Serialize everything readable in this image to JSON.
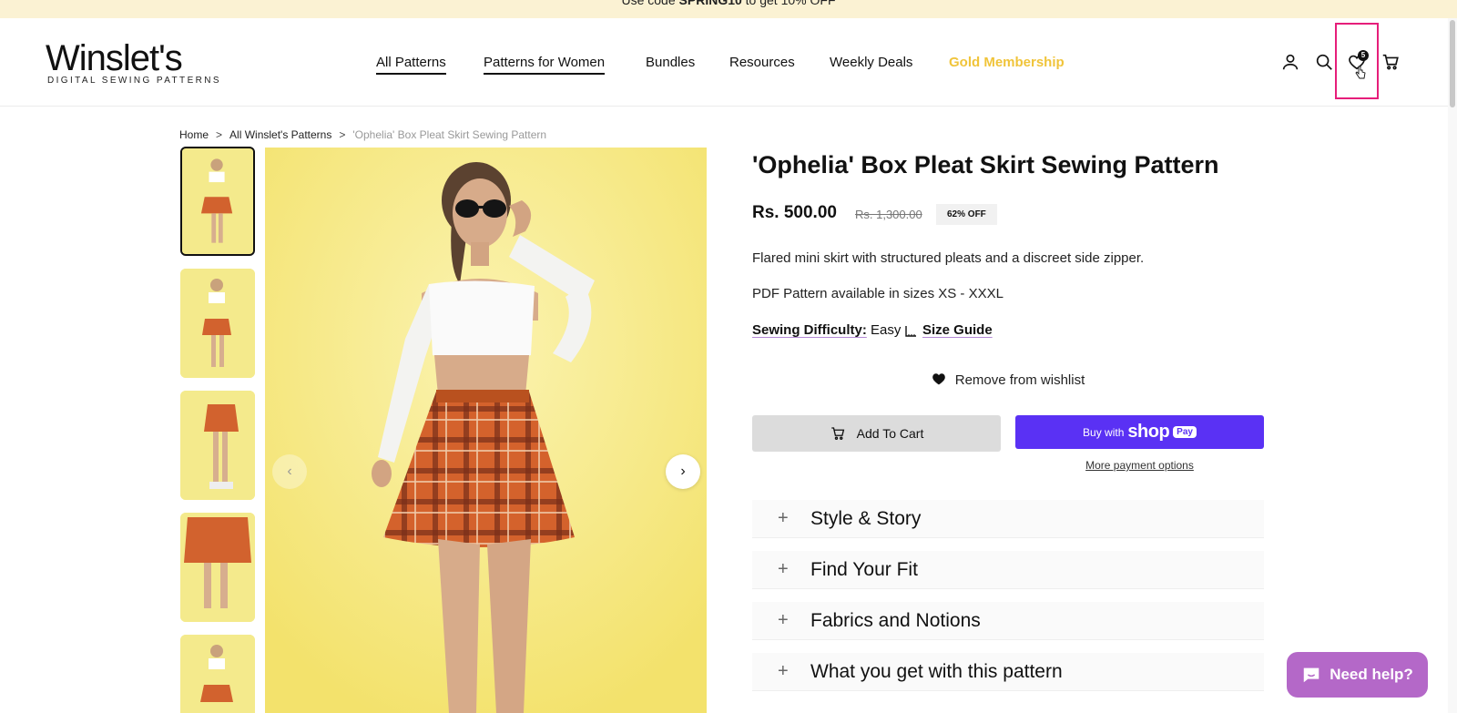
{
  "announcement": {
    "prefix": "Use code ",
    "code": "SPRING10",
    "suffix": " to get 10% OFF"
  },
  "logo": {
    "wordmark": "Winslet's",
    "tagline": "DIGITAL SEWING PATTERNS"
  },
  "nav": {
    "items": [
      {
        "label": "All Patterns"
      },
      {
        "label": "Patterns for Women"
      },
      {
        "label": "Bundles"
      },
      {
        "label": "Resources"
      },
      {
        "label": "Weekly Deals"
      },
      {
        "label": "Gold Membership"
      }
    ],
    "gold_color": "#f0c43a"
  },
  "header_icons": {
    "account": "user-icon",
    "search": "search-icon",
    "wishlist": "heart-icon",
    "wishlist_count": "5",
    "cart": "cart-icon",
    "highlight_color": "#e61e7a"
  },
  "breadcrumb": {
    "home": "Home",
    "collection": "All Winslet's Patterns",
    "current": "'Ophelia' Box Pleat Skirt Sewing Pattern",
    "separator": ">"
  },
  "product": {
    "title": "'Ophelia' Box Pleat Skirt Sewing Pattern",
    "price": "Rs. 500.00",
    "compare_price": "Rs. 1,300.00",
    "discount_badge": "62% OFF",
    "description": "Flared mini skirt with structured pleats and a discreet side zipper.",
    "sizes_note": "PDF Pattern available in sizes XS - XXXL",
    "difficulty_label": "Sewing Difficulty:",
    "difficulty_value": "Easy",
    "size_guide_label": "Size Guide",
    "wishlist_action": "Remove from wishlist",
    "add_to_cart": "Add To Cart",
    "buy_with": "Buy with",
    "shop_word": "shop",
    "pay_word": "Pay",
    "more_payment": "More payment options",
    "shop_color": "#5a31f4"
  },
  "accordion": [
    {
      "label": "Style & Story"
    },
    {
      "label": "Find Your Fit"
    },
    {
      "label": "Fabrics and Notions"
    },
    {
      "label": "What you get with this pattern"
    }
  ],
  "gallery": {
    "prev_icon": "chevron-left-icon",
    "next_icon": "chevron-right-icon",
    "prev_glyph": "‹",
    "next_glyph": "›"
  },
  "chat": {
    "label": "Need help?",
    "color": "#b468c8"
  }
}
